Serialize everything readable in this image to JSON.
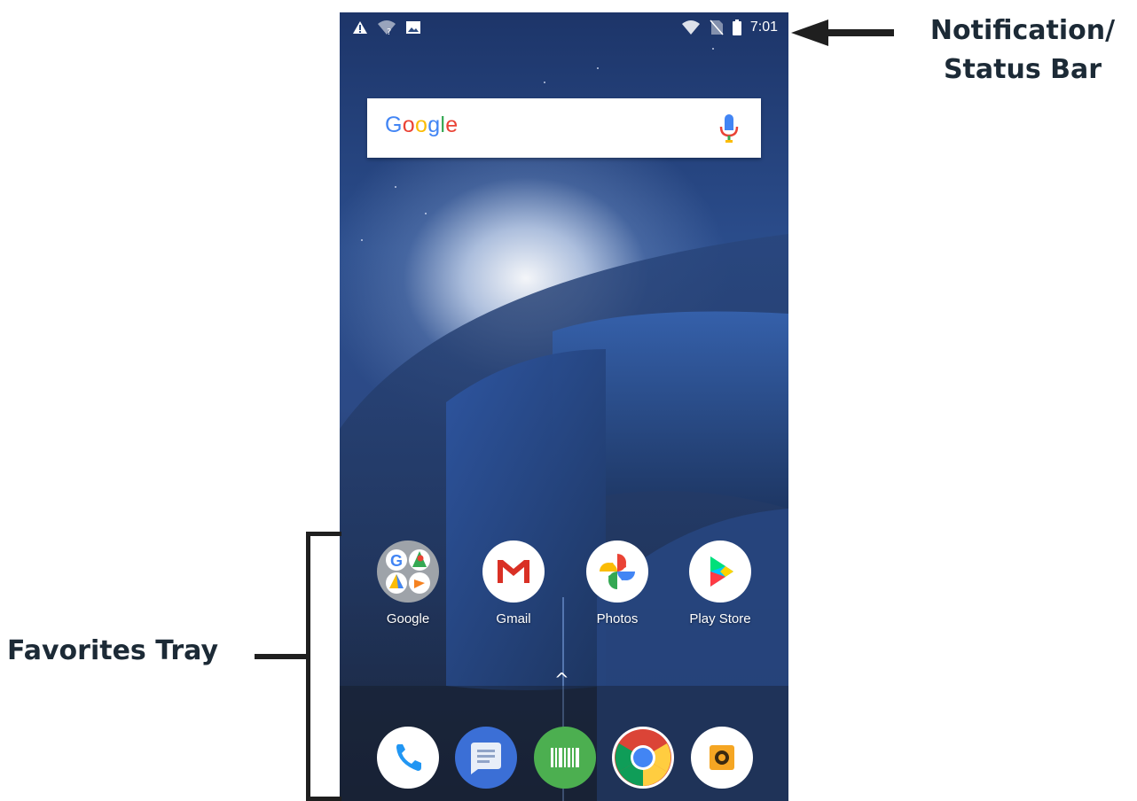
{
  "status_bar": {
    "left_icons": [
      "warning-icon",
      "wifi-unknown-icon",
      "image-icon"
    ],
    "right_icons": [
      "wifi-icon",
      "no-sim-icon",
      "battery-icon"
    ],
    "time": "7:01"
  },
  "search_widget": {
    "logo_text": "Google",
    "logo_letters": [
      {
        "char": "G",
        "color": "#4285F4"
      },
      {
        "char": "o",
        "color": "#EA4335"
      },
      {
        "char": "o",
        "color": "#FBBC05"
      },
      {
        "char": "g",
        "color": "#4285F4"
      },
      {
        "char": "l",
        "color": "#34A853"
      },
      {
        "char": "e",
        "color": "#EA4335"
      }
    ],
    "mic_icon": "microphone-icon"
  },
  "favorites": [
    {
      "label": "Google",
      "icon": "google-folder-icon"
    },
    {
      "label": "Gmail",
      "icon": "gmail-icon"
    },
    {
      "label": "Photos",
      "icon": "photos-icon"
    },
    {
      "label": "Play Store",
      "icon": "play-store-icon"
    }
  ],
  "app_drawer_icon": "chevron-up-icon",
  "dock": [
    {
      "icon": "phone-icon"
    },
    {
      "icon": "messages-icon"
    },
    {
      "icon": "barcode-scanner-icon"
    },
    {
      "icon": "chrome-icon"
    },
    {
      "icon": "camera-icon"
    }
  ],
  "annotations": {
    "status_bar_line1": "Notification/",
    "status_bar_line2": "Status Bar",
    "favorites_tray": "Favorites Tray"
  },
  "colors": {
    "annotation_text": "#1c2a36",
    "wallpaper_dark": "#1d3569"
  }
}
